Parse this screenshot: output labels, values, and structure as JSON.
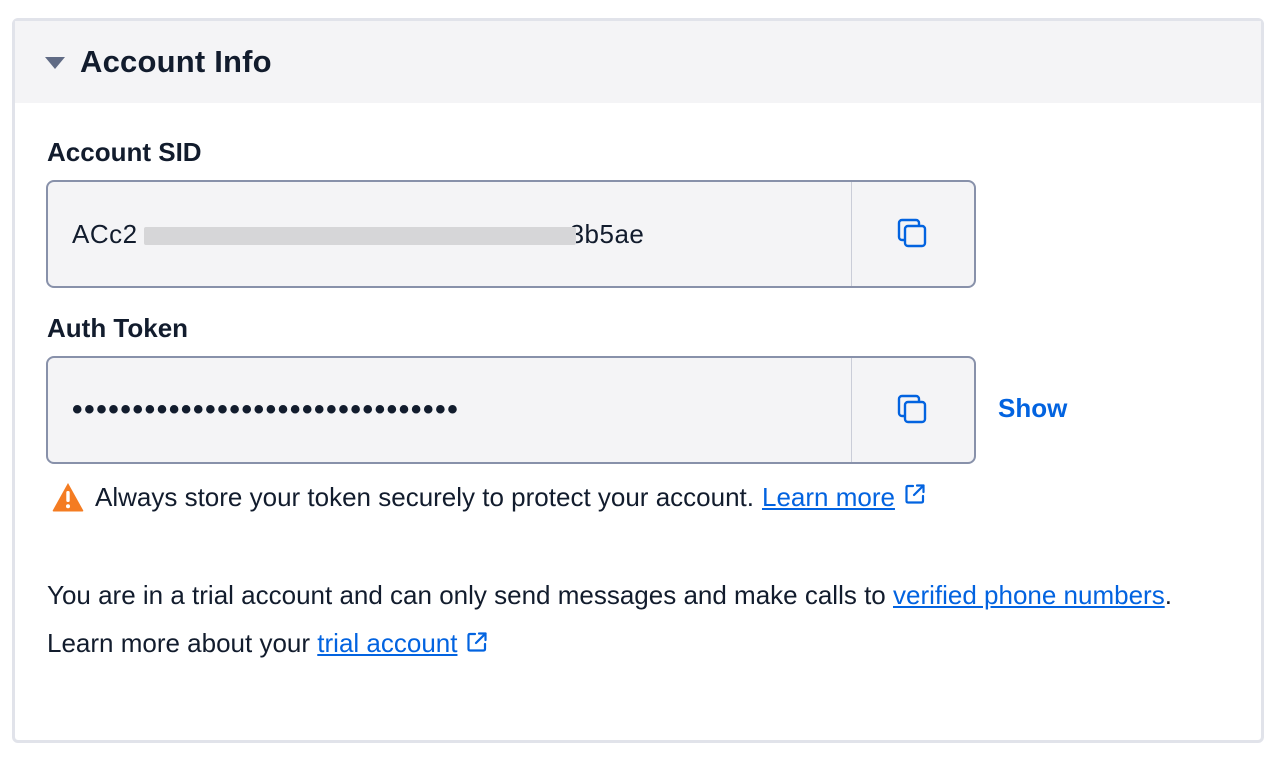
{
  "panel": {
    "title": "Account Info",
    "caret_icon": "caret-down-icon"
  },
  "account_sid": {
    "label": "Account SID",
    "value_prefix": "ACc2",
    "value_suffix": "3b5ae",
    "copy_icon": "copy-icon"
  },
  "auth_token": {
    "label": "Auth Token",
    "masked_value": "••••••••••••••••••••••••••••••••",
    "copy_icon": "copy-icon",
    "show_label": "Show"
  },
  "warning": {
    "icon": "warning-icon",
    "text": "Always store your token securely to protect your account.",
    "link_label": "Learn more",
    "link_icon": "external-link-icon"
  },
  "trial_notice": {
    "text_before": "You are in a trial account and can only send messages and make calls to ",
    "verified_link": "verified phone numbers",
    "text_middle": ". Learn more about your ",
    "trial_link": "trial account",
    "link_icon": "external-link-icon"
  },
  "colors": {
    "link": "#0263e0",
    "warning": "#f47c22",
    "text": "#121c2d",
    "header_bg": "#f4f4f6"
  }
}
